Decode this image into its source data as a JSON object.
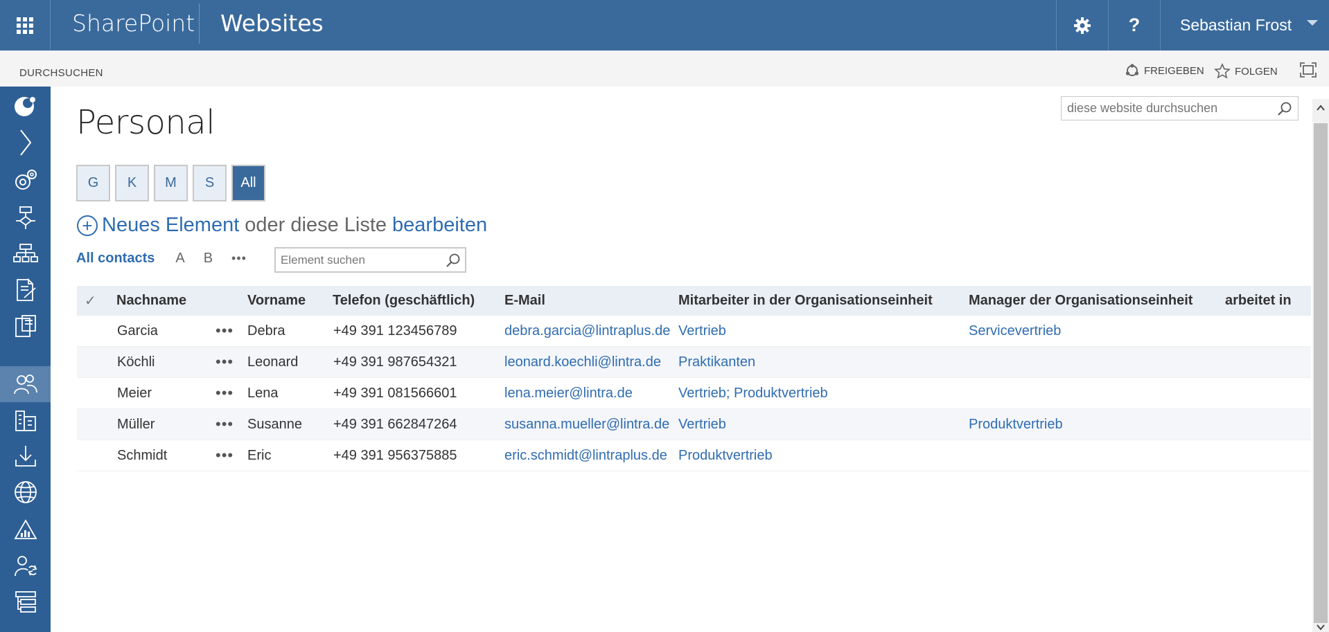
{
  "suitebar": {
    "brand": "SharePoint",
    "site": "Websites",
    "user_name": "Sebastian Frost",
    "settings_icon": "gear-icon",
    "help_label": "?"
  },
  "ribbon": {
    "browse": "DURCHSUCHEN",
    "share": "FREIGEBEN",
    "follow": "FOLGEN"
  },
  "page": {
    "title": "Personal",
    "site_search_placeholder": "diese website durchsuchen"
  },
  "filters": [
    "G",
    "K",
    "M",
    "S",
    "All"
  ],
  "new_item": {
    "link": "Neues Element",
    "middle": "oder diese Liste",
    "edit": "bearbeiten"
  },
  "views": {
    "all_contacts": "All contacts",
    "a": "A",
    "b": "B",
    "more": "•••",
    "search_placeholder": "Element suchen"
  },
  "table": {
    "headers": {
      "check": "✓",
      "lastname": "Nachname",
      "firstname": "Vorname",
      "phone": "Telefon (geschäftlich)",
      "email": "E-Mail",
      "member": "Mitarbeiter in der Organisationseinheit",
      "manager": "Manager der Organisationseinheit",
      "works_in": "arbeitet in"
    },
    "rows": [
      {
        "lastname": "Garcia",
        "firstname": "Debra",
        "phone": "+49 391 123456789",
        "email": "debra.garcia@lintraplus.de",
        "member": "Vertrieb",
        "manager": "Servicevertrieb",
        "works_in": ""
      },
      {
        "lastname": "Köchli",
        "firstname": "Leonard",
        "phone": "+49 391 987654321",
        "email": "leonard.koechli@lintra.de",
        "member": "Praktikanten",
        "manager": "",
        "works_in": ""
      },
      {
        "lastname": "Meier",
        "firstname": "Lena",
        "phone": "+49 391 081566601",
        "email": "lena.meier@lintra.de",
        "member": "Vertrieb; Produktvertrieb",
        "manager": "",
        "works_in": ""
      },
      {
        "lastname": "Müller",
        "firstname": "Susanne",
        "phone": "+49 391 662847264",
        "email": "susanna.mueller@lintra.de",
        "member": "Vertrieb",
        "manager": "Produktvertrieb",
        "works_in": ""
      },
      {
        "lastname": "Schmidt",
        "firstname": "Eric",
        "phone": "+49 391 956375885",
        "email": "eric.schmidt@lintraplus.de",
        "member": "Produktvertrieb",
        "manager": "",
        "works_in": ""
      }
    ],
    "row_menu": "•••"
  },
  "leftnav": {
    "items": [
      "logo-icon",
      "chevron-right-icon",
      "gears-icon",
      "workflow-icon",
      "org-chart-icon",
      "document-edit-icon",
      "device-doc-icon",
      "people-icon",
      "building-icon",
      "download-icon",
      "globe-icon",
      "analytics-icon",
      "person-sync-icon",
      "list-tree-icon"
    ]
  },
  "colors": {
    "suitebar": "#3a6a9c",
    "leftnav": "#2e5f94",
    "leftnav_active": "#5b83ae",
    "link": "#2f6cb1",
    "header_bg": "#eaeff6"
  }
}
